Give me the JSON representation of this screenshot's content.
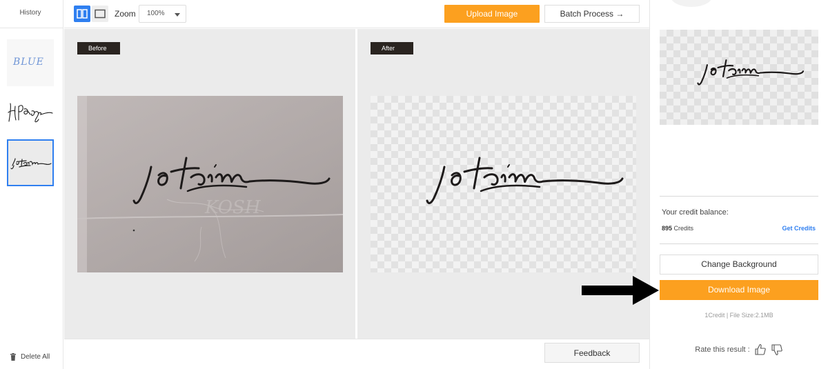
{
  "history": {
    "title": "History",
    "delete_all": "Delete All",
    "items": [
      {
        "name": "history-thumb-blue"
      },
      {
        "name": "history-thumb-signature"
      },
      {
        "name": "history-thumb-jotaime",
        "active": true
      }
    ]
  },
  "toolbar": {
    "zoom_label": "Zoom",
    "zoom_value": "100%",
    "upload_label": "Upload Image",
    "batch_label": "Batch Process →"
  },
  "panels": {
    "before_label": "Before",
    "after_label": "After"
  },
  "bottombar": {
    "feedback_label": "Feedback"
  },
  "right_panel": {
    "credit_label": "Your credit balance:",
    "credit_count": "895",
    "credit_unit": " Credits",
    "get_credits": "Get Credits",
    "change_bg_label": "Change Background",
    "download_label": "Download Image",
    "file_info": "1Credit | File Size:2.1MB",
    "rate_label": "Rate this result :"
  },
  "colors": {
    "accent_orange": "#fca01f",
    "accent_blue": "#2f7ff0",
    "panel_bg": "#ebebeb"
  }
}
